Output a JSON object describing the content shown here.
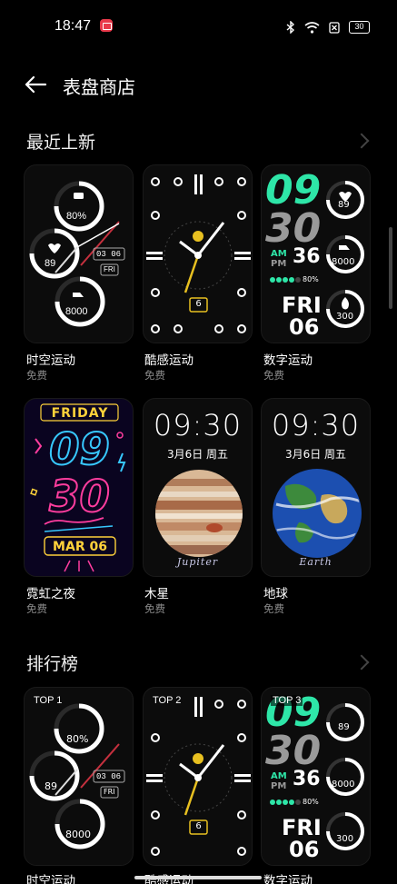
{
  "status_bar": {
    "time": "18:47",
    "battery": "30"
  },
  "header": {
    "title": "表盘商店"
  },
  "sections": [
    {
      "title": "最近上新"
    },
    {
      "title": "排行榜"
    }
  ],
  "recent": [
    {
      "name": "时空运动",
      "price": "免费",
      "style": "sport",
      "metrics": [
        "80%",
        "89",
        "8000"
      ],
      "date": "03 06",
      "weekday": "FRI"
    },
    {
      "name": "酷感运动",
      "price": "免费",
      "style": "analog",
      "day": "6"
    },
    {
      "name": "数字运动",
      "price": "免费",
      "style": "digital",
      "hour": "09",
      "minute": "30",
      "ampm_am": "AM",
      "ampm_pm": "PM",
      "seconds": "36",
      "percent": "80%",
      "weekday": "FRI",
      "day": "06",
      "metrics": [
        "89",
        "8000",
        "300"
      ]
    },
    {
      "name": "霓虹之夜",
      "price": "免费",
      "style": "neon",
      "weekday": "FRIDAY",
      "hour": "09",
      "minute": "30",
      "date": "MAR 06"
    },
    {
      "name": "木星",
      "price": "免费",
      "style": "jupiter",
      "time": "09:30",
      "date": "3月6日 周五",
      "label": "Jupiter"
    },
    {
      "name": "地球",
      "price": "免费",
      "style": "earth",
      "time": "09:30",
      "date": "3月6日 周五",
      "label": "Earth"
    }
  ],
  "ranking": [
    {
      "rank": "TOP 1",
      "name": "时空运动"
    },
    {
      "rank": "TOP 2",
      "name": "酷感运动"
    },
    {
      "rank": "TOP 3",
      "name": "数字运动"
    }
  ],
  "colors": {
    "accent_green": "#2ee6a8",
    "neon_pink": "#ff3d9e",
    "neon_blue": "#37c8ff",
    "neon_yellow": "#ffd23a"
  }
}
